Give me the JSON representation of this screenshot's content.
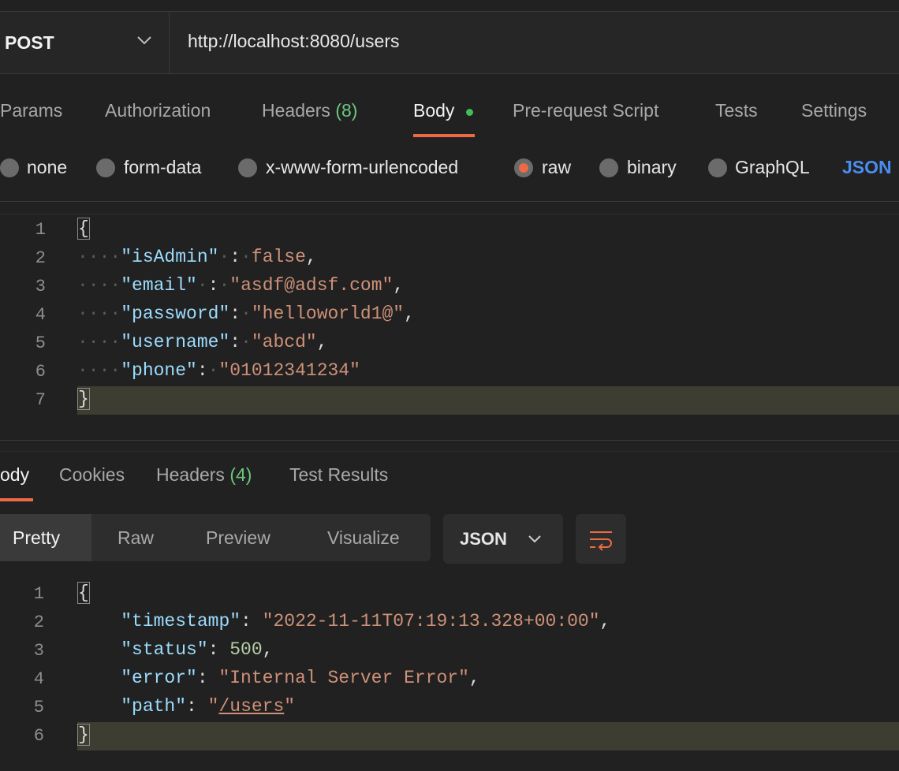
{
  "request": {
    "method": "POST",
    "url": "http://localhost:8080/users"
  },
  "request_tabs": [
    {
      "label": "Params"
    },
    {
      "label": "Authorization"
    },
    {
      "label": "Headers",
      "count": "(8)"
    },
    {
      "label": "Body"
    },
    {
      "label": "Pre-request Script"
    },
    {
      "label": "Tests"
    },
    {
      "label": "Settings"
    }
  ],
  "body_types": [
    {
      "label": "none",
      "checked": false
    },
    {
      "label": "form-data",
      "checked": false
    },
    {
      "label": "x-www-form-urlencoded",
      "checked": false
    },
    {
      "label": "raw",
      "checked": true
    },
    {
      "label": "binary",
      "checked": false
    },
    {
      "label": "GraphQL",
      "checked": false
    }
  ],
  "body_format": "JSON",
  "request_editor": {
    "line_numbers": [
      "1",
      "2",
      "3",
      "4",
      "5",
      "6",
      "7"
    ],
    "lines": [
      [
        {
          "t": "{",
          "c": "brace"
        }
      ],
      [
        {
          "t": "····",
          "c": "ws"
        },
        {
          "t": "\"isAdmin\"",
          "c": "key"
        },
        {
          "t": "·",
          "c": "ws"
        },
        {
          "t": ":",
          "c": "punc"
        },
        {
          "t": "·",
          "c": "ws"
        },
        {
          "t": "false",
          "c": "str"
        },
        {
          "t": ",",
          "c": "punc"
        }
      ],
      [
        {
          "t": "····",
          "c": "ws"
        },
        {
          "t": "\"email\"",
          "c": "key"
        },
        {
          "t": "·",
          "c": "ws"
        },
        {
          "t": ":",
          "c": "punc"
        },
        {
          "t": "·",
          "c": "ws"
        },
        {
          "t": "\"asdf@adsf.com\"",
          "c": "str"
        },
        {
          "t": ",",
          "c": "punc"
        }
      ],
      [
        {
          "t": "····",
          "c": "ws"
        },
        {
          "t": "\"password\"",
          "c": "key"
        },
        {
          "t": ":",
          "c": "punc"
        },
        {
          "t": "·",
          "c": "ws"
        },
        {
          "t": "\"helloworld1@\"",
          "c": "str"
        },
        {
          "t": ",",
          "c": "punc"
        }
      ],
      [
        {
          "t": "····",
          "c": "ws"
        },
        {
          "t": "\"username\"",
          "c": "key"
        },
        {
          "t": ":",
          "c": "punc"
        },
        {
          "t": "·",
          "c": "ws"
        },
        {
          "t": "\"abcd\"",
          "c": "str"
        },
        {
          "t": ",",
          "c": "punc"
        }
      ],
      [
        {
          "t": "····",
          "c": "ws"
        },
        {
          "t": "\"phone\"",
          "c": "key"
        },
        {
          "t": ":",
          "c": "punc"
        },
        {
          "t": "·",
          "c": "ws"
        },
        {
          "t": "\"01012341234\"",
          "c": "str"
        }
      ],
      [
        {
          "t": "}",
          "c": "brace"
        }
      ]
    ]
  },
  "response_tabs": [
    {
      "label": "ody"
    },
    {
      "label": "Cookies"
    },
    {
      "label": "Headers",
      "count": "(4)"
    },
    {
      "label": "Test Results"
    }
  ],
  "view_modes": [
    {
      "label": "Pretty"
    },
    {
      "label": "Raw"
    },
    {
      "label": "Preview"
    },
    {
      "label": "Visualize"
    }
  ],
  "response_format": "JSON",
  "response_editor": {
    "line_numbers": [
      "1",
      "2",
      "3",
      "4",
      "5",
      "6"
    ],
    "lines": [
      [
        {
          "t": "{",
          "c": "brace"
        }
      ],
      [
        {
          "t": "    ",
          "c": "sp"
        },
        {
          "t": "\"timestamp\"",
          "c": "key"
        },
        {
          "t": ": ",
          "c": "punc"
        },
        {
          "t": "\"2022-11-11T07:19:13.328+00:00\"",
          "c": "str"
        },
        {
          "t": ",",
          "c": "punc"
        }
      ],
      [
        {
          "t": "    ",
          "c": "sp"
        },
        {
          "t": "\"status\"",
          "c": "key"
        },
        {
          "t": ": ",
          "c": "punc"
        },
        {
          "t": "500",
          "c": "num"
        },
        {
          "t": ",",
          "c": "punc"
        }
      ],
      [
        {
          "t": "    ",
          "c": "sp"
        },
        {
          "t": "\"error\"",
          "c": "key"
        },
        {
          "t": ": ",
          "c": "punc"
        },
        {
          "t": "\"Internal Server Error\"",
          "c": "str"
        },
        {
          "t": ",",
          "c": "punc"
        }
      ],
      [
        {
          "t": "    ",
          "c": "sp"
        },
        {
          "t": "\"path\"",
          "c": "key"
        },
        {
          "t": ": ",
          "c": "punc"
        },
        {
          "t": "\"",
          "c": "str"
        },
        {
          "t": "/users",
          "c": "link"
        },
        {
          "t": "\"",
          "c": "str"
        }
      ],
      [
        {
          "t": "}",
          "c": "brace"
        }
      ]
    ]
  },
  "colors": {
    "accent": "#ee6a45",
    "count": "#6bc77d",
    "link": "#4a8df0",
    "key": "#9cdcfe",
    "string": "#ce9178",
    "number": "#b5cea8"
  },
  "icons": {
    "method_dropdown": "chevron-down-icon",
    "format_dropdown": "chevron-down-icon",
    "wrap": "wrap-lines-icon"
  }
}
